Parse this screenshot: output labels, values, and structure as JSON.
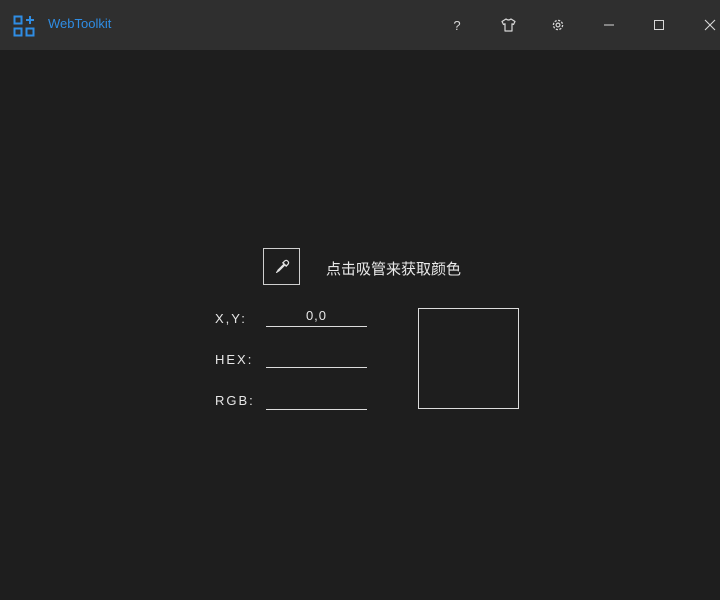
{
  "app": {
    "title": "WebToolkit",
    "accent_color": "#2f8de4",
    "logo_icon": "app-grid-plus-icon"
  },
  "titlebar": {
    "help_label": "?",
    "icons": [
      "shirt-icon",
      "gear-icon",
      "minimize-icon",
      "maximize-icon",
      "close-icon"
    ]
  },
  "picker": {
    "button_icon": "eyedropper-icon",
    "hint": "点击吸管来获取颜色"
  },
  "fields": {
    "xy": {
      "label": "X,Y:",
      "value": "0,0"
    },
    "hex": {
      "label": "HEX:",
      "value": ""
    },
    "rgb": {
      "label": "RGB:",
      "value": ""
    }
  },
  "swatch": {
    "color": "#1e1e1e"
  }
}
